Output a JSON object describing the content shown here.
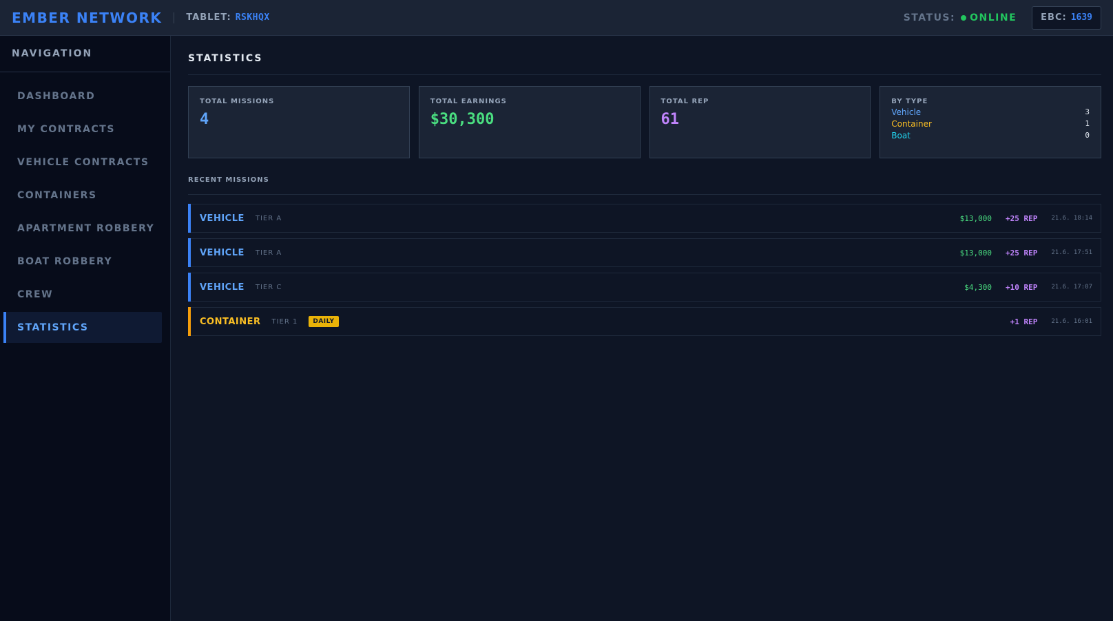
{
  "header": {
    "brand": "EMBER NETWORK",
    "tablet_label": "TABLET:",
    "tablet_id": "RSKHQX",
    "status_label": "STATUS:",
    "status_value": "ONLINE",
    "ebc_label": "EBC:",
    "ebc_value": "1639"
  },
  "sidebar": {
    "title": "NAVIGATION",
    "items": [
      {
        "label": "DASHBOARD"
      },
      {
        "label": "MY CONTRACTS"
      },
      {
        "label": "VEHICLE CONTRACTS"
      },
      {
        "label": "CONTAINERS"
      },
      {
        "label": "APARTMENT ROBBERY"
      },
      {
        "label": "BOAT ROBBERY"
      },
      {
        "label": "CREW"
      },
      {
        "label": "STATISTICS"
      }
    ],
    "active_index": 7
  },
  "main": {
    "title": "STATISTICS",
    "cards": {
      "missions": {
        "label": "TOTAL MISSIONS",
        "value": "4"
      },
      "earnings": {
        "label": "TOTAL EARNINGS",
        "value": "$30,300"
      },
      "rep": {
        "label": "TOTAL REP",
        "value": "61"
      },
      "by_type": {
        "label": "BY TYPE",
        "rows": [
          {
            "name": "Vehicle",
            "count": "3",
            "color": "#60a5fa"
          },
          {
            "name": "Container",
            "count": "1",
            "color": "#fbbf24"
          },
          {
            "name": "Boat",
            "count": "0",
            "color": "#22d3ee"
          }
        ]
      }
    },
    "recent_title": "RECENT MISSIONS",
    "missions": [
      {
        "type": "VEHICLE",
        "tier": "TIER A",
        "badge": "",
        "earnings": "$13,000",
        "rep": "+25 REP",
        "time": "21.6. 18:14",
        "color": "#60a5fa",
        "accent": "#3b82f6"
      },
      {
        "type": "VEHICLE",
        "tier": "TIER A",
        "badge": "",
        "earnings": "$13,000",
        "rep": "+25 REP",
        "time": "21.6. 17:51",
        "color": "#60a5fa",
        "accent": "#3b82f6"
      },
      {
        "type": "VEHICLE",
        "tier": "TIER C",
        "badge": "",
        "earnings": "$4,300",
        "rep": "+10 REP",
        "time": "21.6. 17:07",
        "color": "#60a5fa",
        "accent": "#3b82f6"
      },
      {
        "type": "CONTAINER",
        "tier": "TIER 1",
        "badge": "DAILY",
        "earnings": "",
        "rep": "+1 REP",
        "time": "21.6. 16:01",
        "color": "#fbbf24",
        "accent": "#f59e0b"
      }
    ]
  }
}
